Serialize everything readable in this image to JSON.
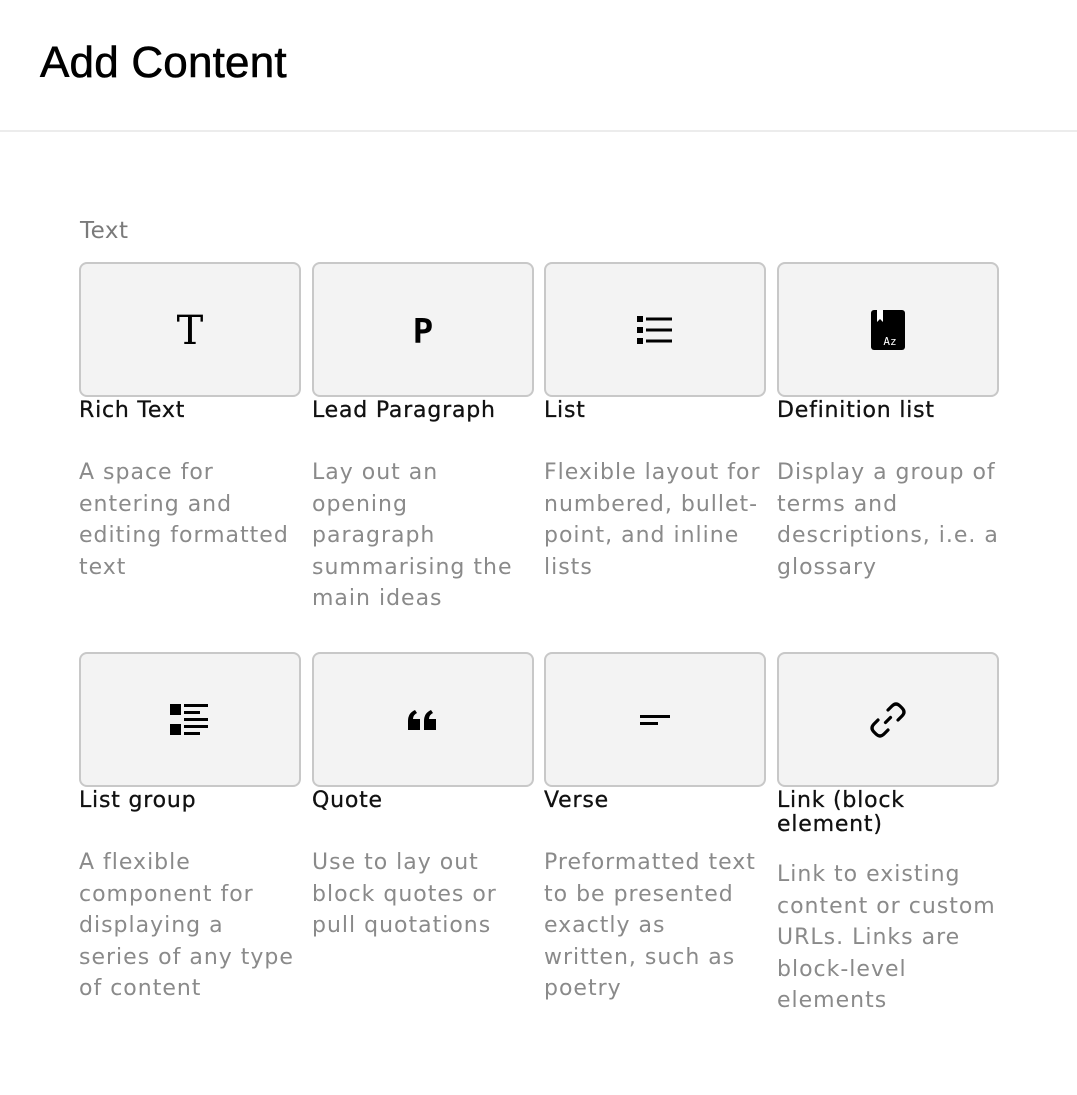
{
  "header": {
    "title": "Add Content"
  },
  "section": {
    "label": "Text"
  },
  "blocks": [
    {
      "title": "Rich Text",
      "description": "A space for entering and editing formatted text",
      "icon": "rich-text-icon"
    },
    {
      "title": "Lead Paragraph",
      "description": "Lay out an opening paragraph summarising the main ideas",
      "icon": "paragraph-icon"
    },
    {
      "title": "List",
      "description": "Flexible layout for numbered, bullet-point, and inline lists",
      "icon": "list-icon"
    },
    {
      "title": "Definition list",
      "description": "Display a group of terms and descriptions, i.e. a glossary",
      "icon": "glossary-book-icon"
    },
    {
      "title": "List group",
      "description": "A flexible component for displaying a series of any type of content",
      "icon": "list-group-icon"
    },
    {
      "title": "Quote",
      "description": "Use to lay out block quotes or pull quotations",
      "icon": "quote-icon"
    },
    {
      "title": "Verse",
      "description": "Preformatted text to be presented exactly as written, such as poetry",
      "icon": "verse-icon"
    },
    {
      "title": "Link (block element)",
      "description": "Link to existing content or custom URLs. Links are block-level elements",
      "icon": "link-icon"
    }
  ]
}
